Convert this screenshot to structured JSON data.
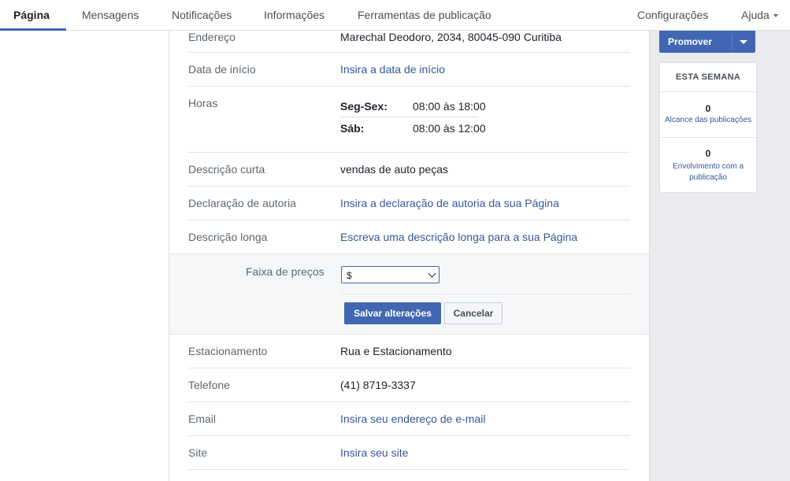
{
  "nav": {
    "tabs": [
      {
        "label": "Página"
      },
      {
        "label": "Mensagens"
      },
      {
        "label": "Notificações"
      },
      {
        "label": "Informações"
      },
      {
        "label": "Ferramentas de publicação"
      }
    ],
    "settings": "Configurações",
    "help": "Ajuda"
  },
  "info": {
    "address": {
      "label": "Endereço",
      "value": "Marechal Deodoro, 2034, 80045-090 Curitiba"
    },
    "start_date": {
      "label": "Data de início",
      "value": "Insira a data de início"
    },
    "hours": {
      "label": "Horas",
      "rows": [
        {
          "day": "Seg-Sex:",
          "time": "08:00 às 18:00"
        },
        {
          "day": "Sáb:",
          "time": "08:00 às 12:00"
        }
      ]
    },
    "short_desc": {
      "label": "Descrição curta",
      "value": "vendas de auto peças"
    },
    "authorship": {
      "label": "Declaração de autoria",
      "value": "Insira a declaração de autoria da sua Página"
    },
    "long_desc": {
      "label": "Descrição longa",
      "value": "Escreva uma descrição longa para a sua Página"
    },
    "price_range": {
      "label": "Faixa de preços",
      "selected": "$"
    },
    "save_label": "Salvar alterações",
    "cancel_label": "Cancelar",
    "parking": {
      "label": "Estacionamento",
      "value": "Rua e Estacionamento"
    },
    "phone": {
      "label": "Telefone",
      "value": "(41) 8719-3337"
    },
    "email": {
      "label": "Email",
      "value": "Insira seu endereço de e-mail"
    },
    "site": {
      "label": "Site",
      "value": "Insira seu site"
    }
  },
  "sidebar": {
    "promote_label": "Promover",
    "week_title": "ESTA SEMANA",
    "stats": [
      {
        "value": "0",
        "label": "Alcance das publicações"
      },
      {
        "value": "0",
        "label": "Envolvimento com a publicação"
      }
    ]
  },
  "colors": {
    "accent": "#4267b2",
    "link": "#365899"
  }
}
